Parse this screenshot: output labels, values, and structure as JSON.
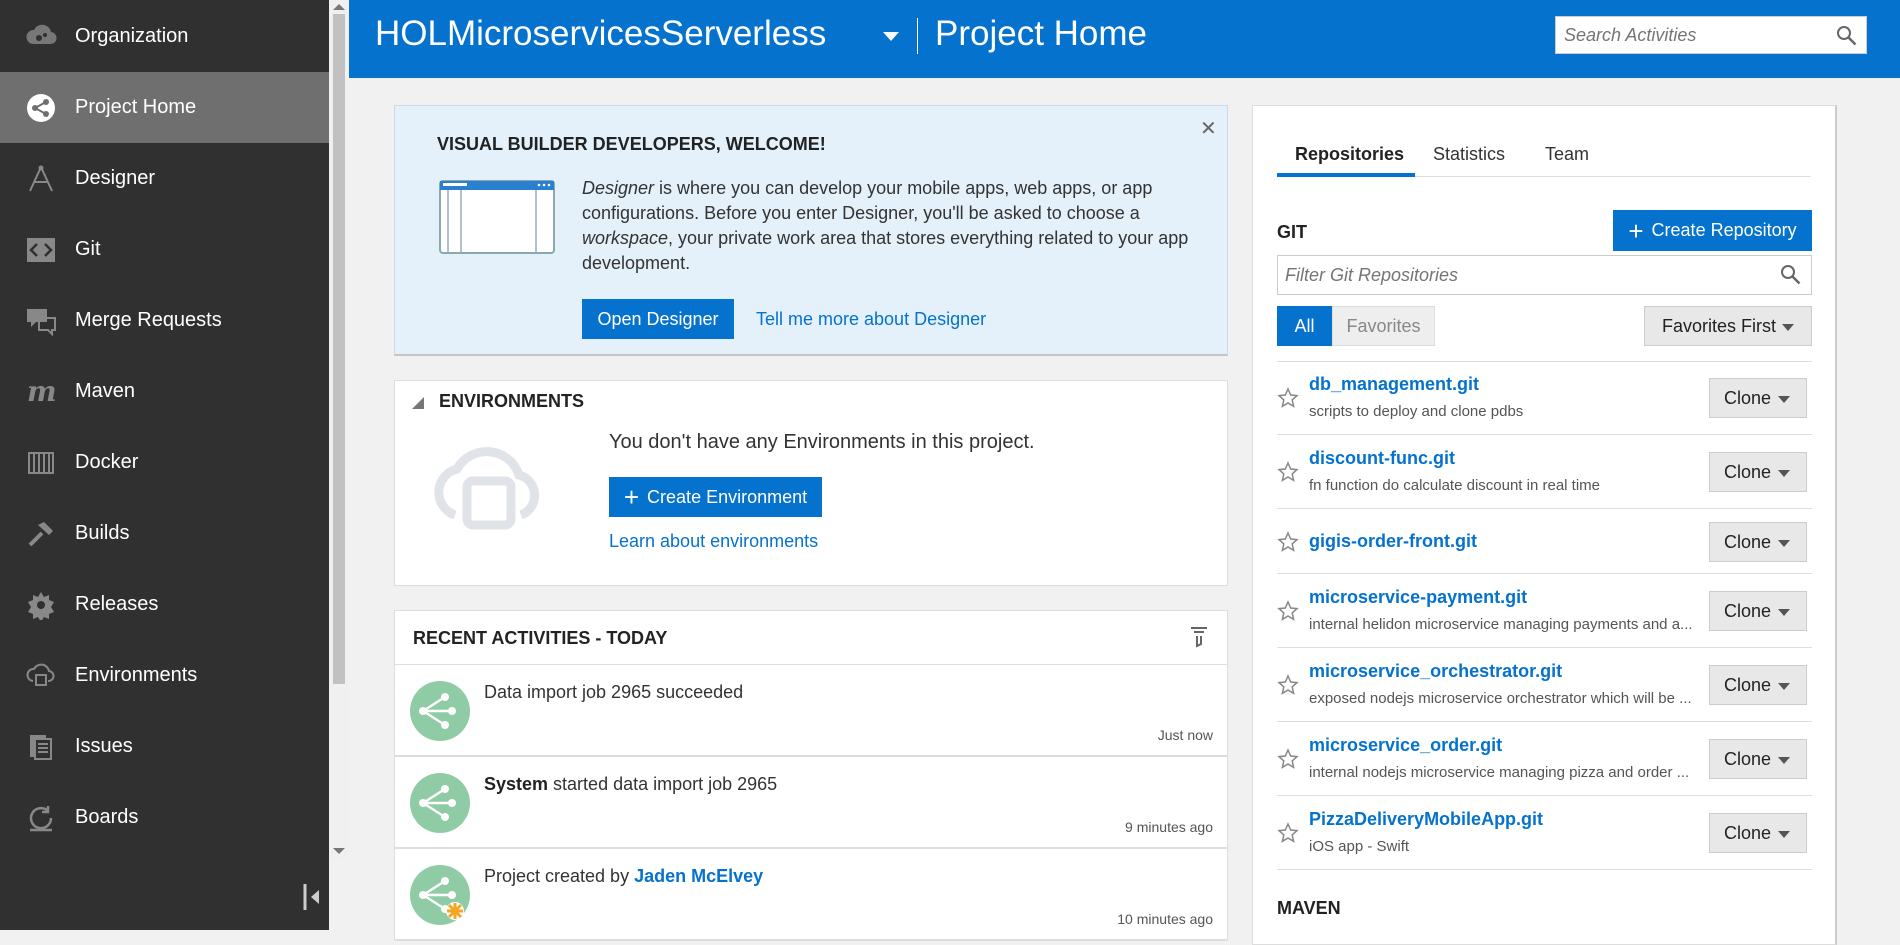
{
  "sidebar": {
    "items": [
      {
        "label": "Organization",
        "icon": "organization-icon"
      },
      {
        "label": "Project Home",
        "icon": "project-home-icon",
        "active": true
      },
      {
        "label": "Designer",
        "icon": "designer-icon"
      },
      {
        "label": "Git",
        "icon": "git-icon"
      },
      {
        "label": "Merge Requests",
        "icon": "merge-requests-icon"
      },
      {
        "label": "Maven",
        "icon": "maven-icon"
      },
      {
        "label": "Docker",
        "icon": "docker-icon"
      },
      {
        "label": "Builds",
        "icon": "builds-icon"
      },
      {
        "label": "Releases",
        "icon": "releases-icon"
      },
      {
        "label": "Environments",
        "icon": "environments-icon"
      },
      {
        "label": "Issues",
        "icon": "issues-icon"
      },
      {
        "label": "Boards",
        "icon": "boards-icon"
      }
    ]
  },
  "header": {
    "project_name": "HOLMicroservicesServerless",
    "page_title": "Project Home",
    "search_placeholder": "Search Activities"
  },
  "welcome": {
    "title": "VISUAL BUILDER DEVELOPERS, WELCOME!",
    "text_em1": "Designer",
    "text_1": " is where you can develop your mobile apps, web apps, or app configurations. Before you enter Designer, you'll be asked to choose a ",
    "text_em2": "workspace",
    "text_2": ", your private work area that stores everything related to your app development.",
    "open_button": "Open Designer",
    "link": "Tell me more about Designer"
  },
  "environments": {
    "title": "ENVIRONMENTS",
    "empty_text": "You don't have any Environments in this project.",
    "create_button": "Create Environment",
    "learn_link": "Learn about environments"
  },
  "activities": {
    "title": "RECENT ACTIVITIES - TODAY",
    "items": [
      {
        "prefix": "",
        "text": "Data import job 2965 succeeded",
        "suffix": "",
        "time": "Just now"
      },
      {
        "prefix": "System",
        "text": " started data import job 2965",
        "suffix": "",
        "time": "9 minutes ago"
      },
      {
        "prefix": "",
        "text": "Project created by ",
        "suffix": "Jaden McElvey",
        "time": "10 minutes ago"
      }
    ]
  },
  "repos_panel": {
    "tabs": [
      "Repositories",
      "Statistics",
      "Team"
    ],
    "git_label": "GIT",
    "create_button": "Create Repository",
    "filter_placeholder": "Filter Git Repositories",
    "filter_all": "All",
    "filter_favorites": "Favorites",
    "sort_label": "Favorites First",
    "clone_label": "Clone",
    "maven_label": "MAVEN",
    "repos": [
      {
        "name": "db_management.git",
        "desc": "scripts to deploy and clone pdbs"
      },
      {
        "name": "discount-func.git",
        "desc": "fn function do calculate discount in real time"
      },
      {
        "name": "gigis-order-front.git",
        "desc": ""
      },
      {
        "name": "microservice-payment.git",
        "desc": "internal helidon microservice managing payments and a..."
      },
      {
        "name": "microservice_orchestrator.git",
        "desc": "exposed nodejs microservice orchestrator which will be ..."
      },
      {
        "name": "microservice_order.git",
        "desc": "internal nodejs microservice managing pizza and order ..."
      },
      {
        "name": "PizzaDeliveryMobileApp.git",
        "desc": "iOS app - Swift"
      }
    ]
  },
  "colors": {
    "accent": "#0572ce",
    "sidebar": "#303030",
    "sidebar_active": "#6f6f6f",
    "activity_icon": "#8fcca6"
  }
}
